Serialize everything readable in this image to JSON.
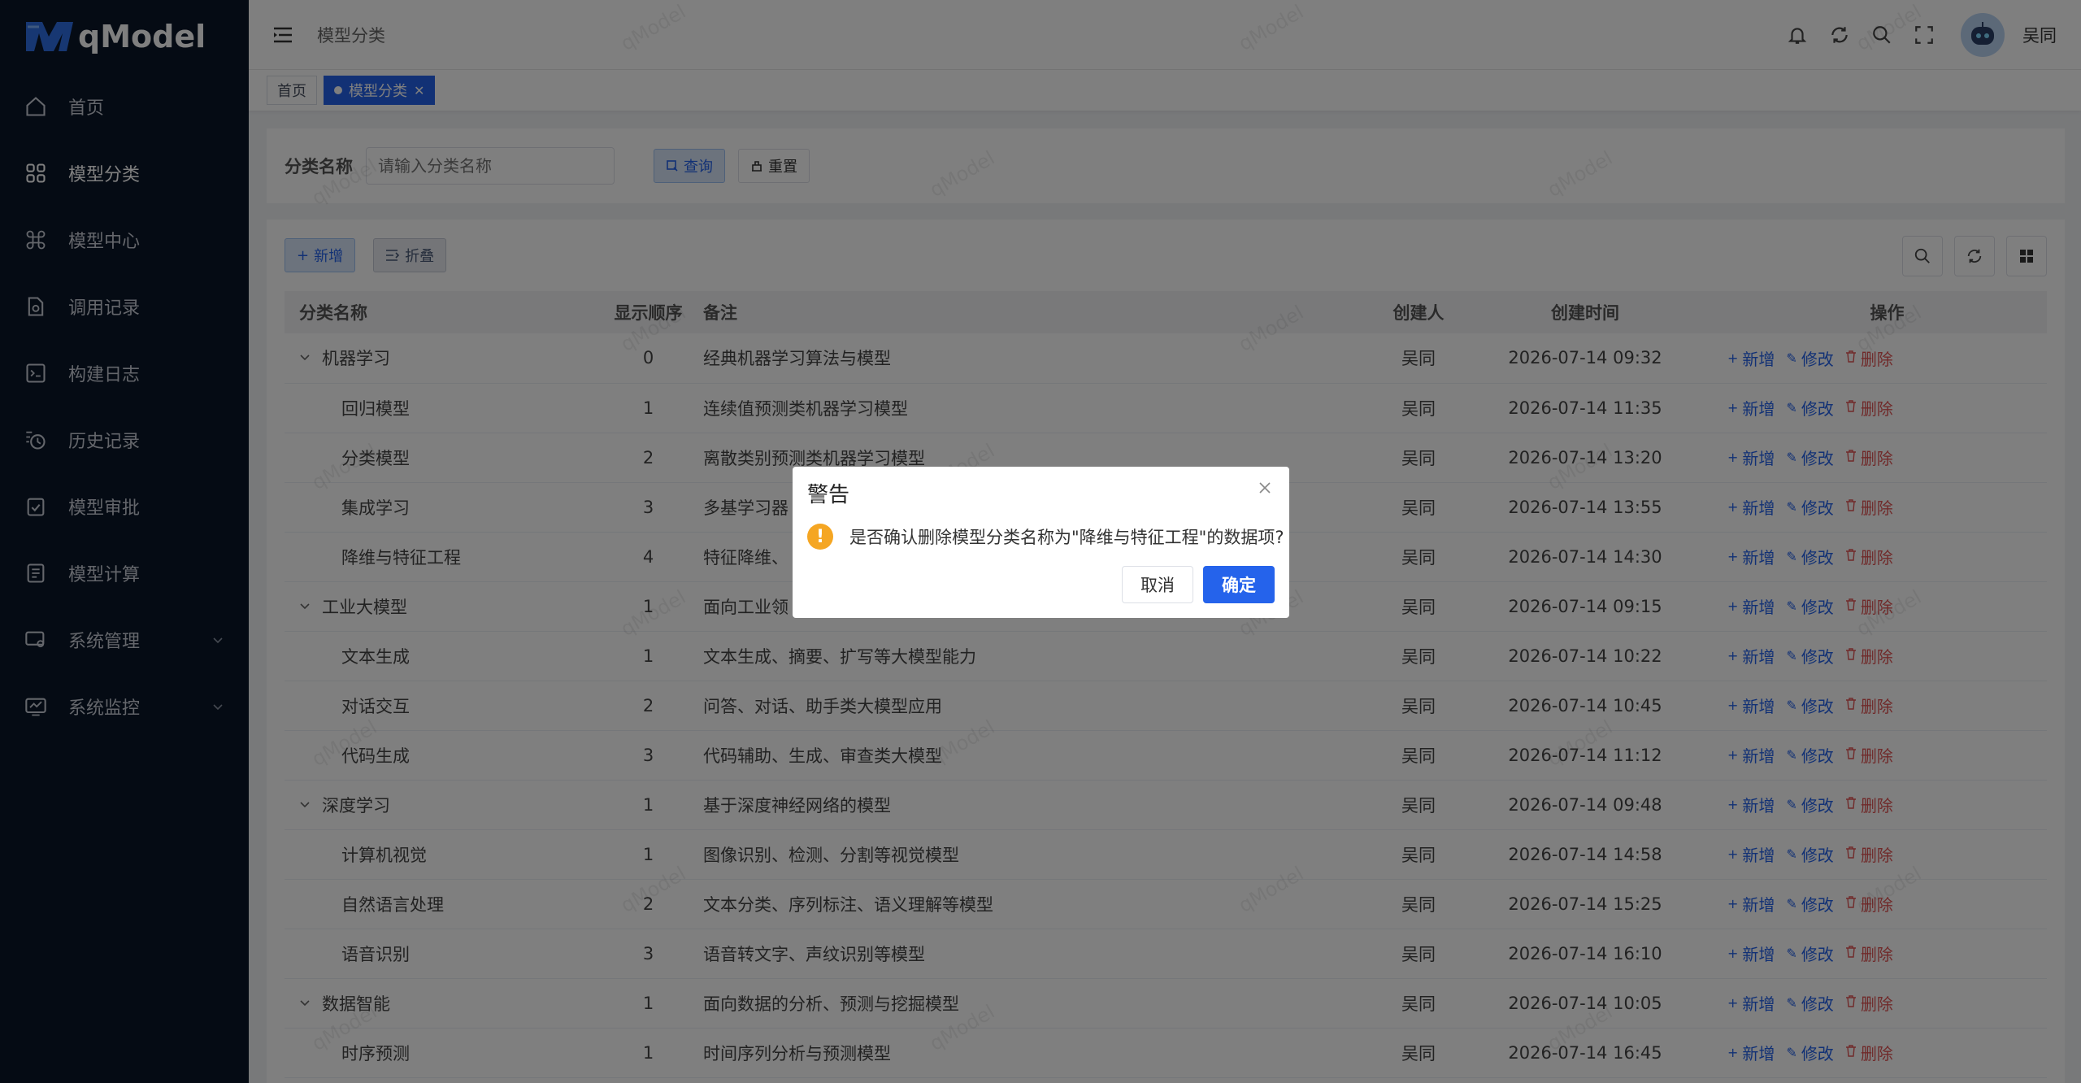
{
  "app": {
    "name": "qModel"
  },
  "sidebar": {
    "items": [
      {
        "label": "首页",
        "icon": "home-icon"
      },
      {
        "label": "模型分类",
        "icon": "grid-icon"
      },
      {
        "label": "模型中心",
        "icon": "command-icon"
      },
      {
        "label": "调用记录",
        "icon": "file-search-icon"
      },
      {
        "label": "构建日志",
        "icon": "terminal-icon"
      },
      {
        "label": "历史记录",
        "icon": "history-icon"
      },
      {
        "label": "模型审批",
        "icon": "check-square-icon"
      },
      {
        "label": "模型计算",
        "icon": "calculator-icon"
      },
      {
        "label": "系统管理",
        "icon": "settings-monitor-icon"
      },
      {
        "label": "系统监控",
        "icon": "chart-monitor-icon"
      }
    ],
    "active": "模型分类"
  },
  "header": {
    "breadcrumb": "模型分类",
    "user": "吴同"
  },
  "tags": [
    {
      "label": "首页"
    },
    {
      "label": "模型分类"
    }
  ],
  "search": {
    "label": "分类名称",
    "placeholder": "请输入分类名称",
    "query_label": "查询",
    "reset_label": "重置"
  },
  "toolbar": {
    "add_label": "新增",
    "fold_label": "折叠"
  },
  "table": {
    "headers": [
      "分类名称",
      "显示顺序",
      "备注",
      "创建人",
      "创建时间",
      "操作"
    ],
    "op_labels": {
      "add": "新增",
      "edit": "修改",
      "del": "删除"
    },
    "rows": [
      {
        "name": "机器学习",
        "sort": "0",
        "remark": "经典机器学习算法与模型",
        "creator": "吴同",
        "time": "2026-07-14 09:32"
      },
      {
        "name": "回归模型",
        "sort": "1",
        "remark": "连续值预测类机器学习模型",
        "creator": "吴同",
        "time": "2026-07-14 11:35"
      },
      {
        "name": "分类模型",
        "sort": "2",
        "remark": "离散类别预测类机器学习模型",
        "creator": "吴同",
        "time": "2026-07-14 13:20"
      },
      {
        "name": "集成学习",
        "sort": "3",
        "remark": "多基学习器",
        "creator": "吴同",
        "time": "2026-07-14 13:55"
      },
      {
        "name": "降维与特征工程",
        "sort": "4",
        "remark": "特征降维、",
        "creator": "吴同",
        "time": "2026-07-14 14:30"
      },
      {
        "name": "工业大模型",
        "sort": "1",
        "remark": "面向工业领",
        "creator": "吴同",
        "time": "2026-07-14 09:15"
      },
      {
        "name": "文本生成",
        "sort": "1",
        "remark": "文本生成、摘要、扩写等大模型能力",
        "creator": "吴同",
        "time": "2026-07-14 10:22"
      },
      {
        "name": "对话交互",
        "sort": "2",
        "remark": "问答、对话、助手类大模型应用",
        "creator": "吴同",
        "time": "2026-07-14 10:45"
      },
      {
        "name": "代码生成",
        "sort": "3",
        "remark": "代码辅助、生成、审查类大模型",
        "creator": "吴同",
        "time": "2026-07-14 11:12"
      },
      {
        "name": "深度学习",
        "sort": "1",
        "remark": "基于深度神经网络的模型",
        "creator": "吴同",
        "time": "2026-07-14 09:48"
      },
      {
        "name": "计算机视觉",
        "sort": "1",
        "remark": "图像识别、检测、分割等视觉模型",
        "creator": "吴同",
        "time": "2026-07-14 14:58"
      },
      {
        "name": "自然语言处理",
        "sort": "2",
        "remark": "文本分类、序列标注、语义理解等模型",
        "creator": "吴同",
        "time": "2026-07-14 15:25"
      },
      {
        "name": "语音识别",
        "sort": "3",
        "remark": "语音转文字、声纹识别等模型",
        "creator": "吴同",
        "time": "2026-07-14 16:10"
      },
      {
        "name": "数据智能",
        "sort": "1",
        "remark": "面向数据的分析、预测与挖掘模型",
        "creator": "吴同",
        "time": "2026-07-14 10:05"
      },
      {
        "name": "时序预测",
        "sort": "1",
        "remark": "时间序列分析与预测模型",
        "creator": "吴同",
        "time": "2026-07-14 16:45"
      }
    ]
  },
  "watermark": "qModel",
  "dialog": {
    "title": "警告",
    "message": "是否确认删除模型分类名称为\"降维与特征工程\"的数据项?",
    "cancel_label": "取消",
    "ok_label": "确定"
  },
  "colors": {
    "primary": "#2563eb",
    "sidebar_bg": "#0a1628",
    "danger": "#e05454",
    "warning": "#f5a623"
  }
}
